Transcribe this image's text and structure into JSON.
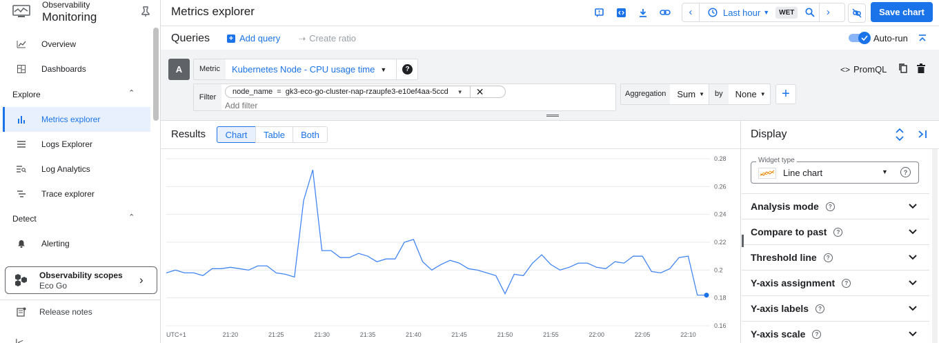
{
  "sidebar": {
    "product_small": "Observability",
    "product_title": "Monitoring",
    "items_top": [
      {
        "label": "Overview",
        "icon": "chart-icon"
      },
      {
        "label": "Dashboards",
        "icon": "dashboard-icon"
      }
    ],
    "explore_label": "Explore",
    "explore_items": [
      {
        "label": "Metrics explorer",
        "icon": "bar-chart-icon",
        "active": true
      },
      {
        "label": "Logs Explorer",
        "icon": "list-icon"
      },
      {
        "label": "Log Analytics",
        "icon": "search-list-icon"
      },
      {
        "label": "Trace explorer",
        "icon": "trace-icon"
      }
    ],
    "detect_label": "Detect",
    "detect_items": [
      {
        "label": "Alerting",
        "icon": "bell-icon"
      }
    ],
    "scopes_title": "Observability scopes",
    "scopes_value": "Eco Go",
    "release_notes": "Release notes"
  },
  "header": {
    "title": "Metrics explorer",
    "time_range": "Last hour",
    "timezone": "WET",
    "save_label": "Save chart"
  },
  "queries": {
    "title": "Queries",
    "add_query": "Add query",
    "create_ratio": "Create ratio",
    "auto_run": "Auto-run",
    "query_letter": "A",
    "metric_label": "Metric",
    "metric_value": "Kubernetes Node - CPU usage time",
    "filter_label": "Filter",
    "filter_chip": "node_name  =  gk3-eco-go-cluster-nap-rzaupfe3-e10ef4aa-5ccd",
    "add_filter_placeholder": "Add filter",
    "aggregation_label": "Aggregation",
    "aggregation_value": "Sum",
    "by_label": "by",
    "by_value": "None",
    "promql": "PromQL"
  },
  "results": {
    "title": "Results",
    "tabs": [
      "Chart",
      "Table",
      "Both"
    ],
    "active_tab": "Chart"
  },
  "display": {
    "title": "Display",
    "widget_type_label": "Widget type",
    "widget_type_value": "Line chart",
    "sections": [
      "Analysis mode",
      "Compare to past",
      "Threshold line",
      "Y-axis assignment",
      "Y-axis labels",
      "Y-axis scale"
    ]
  },
  "colors": {
    "accent": "#1a73e8",
    "line": "#4285f4"
  },
  "chart_data": {
    "type": "line",
    "x_tick_labels": [
      "UTC+1",
      "21:20",
      "21:25",
      "21:30",
      "21:35",
      "21:40",
      "21:45",
      "21:50",
      "21:55",
      "22:00",
      "22:05",
      "22:10"
    ],
    "y_tick_labels": [
      "0.28",
      "0.26",
      "0.24",
      "0.22",
      "0.2",
      "0.18",
      "0.16"
    ],
    "ylim": [
      0.16,
      0.28
    ],
    "grid": true,
    "series": [
      {
        "x": [
          "21:13",
          "21:14",
          "21:15",
          "21:16",
          "21:17",
          "21:18",
          "21:19",
          "21:20",
          "21:21",
          "21:22",
          "21:23",
          "21:24",
          "21:25",
          "21:26",
          "21:27",
          "21:28",
          "21:29",
          "21:30",
          "21:31",
          "21:32",
          "21:33",
          "21:34",
          "21:35",
          "21:36",
          "21:37",
          "21:38",
          "21:39",
          "21:40",
          "21:41",
          "21:42",
          "21:43",
          "21:44",
          "21:45",
          "21:46",
          "21:47",
          "21:48",
          "21:49",
          "21:50",
          "21:51",
          "21:52",
          "21:53",
          "21:54",
          "21:55",
          "21:56",
          "21:57",
          "21:58",
          "21:59",
          "22:00",
          "22:01",
          "22:02",
          "22:03",
          "22:04",
          "22:05",
          "22:06",
          "22:07",
          "22:08",
          "22:09",
          "22:10",
          "22:11",
          "22:12"
        ],
        "values": [
          0.198,
          0.2,
          0.198,
          0.198,
          0.196,
          0.201,
          0.201,
          0.202,
          0.201,
          0.2,
          0.203,
          0.203,
          0.198,
          0.197,
          0.195,
          0.25,
          0.272,
          0.214,
          0.214,
          0.209,
          0.209,
          0.212,
          0.21,
          0.206,
          0.208,
          0.208,
          0.22,
          0.222,
          0.206,
          0.2,
          0.204,
          0.207,
          0.205,
          0.201,
          0.2,
          0.198,
          0.196,
          0.183,
          0.197,
          0.196,
          0.205,
          0.211,
          0.204,
          0.2,
          0.202,
          0.205,
          0.205,
          0.202,
          0.201,
          0.206,
          0.205,
          0.21,
          0.21,
          0.199,
          0.198,
          0.201,
          0.209,
          0.21,
          0.182,
          0.182
        ]
      }
    ]
  }
}
